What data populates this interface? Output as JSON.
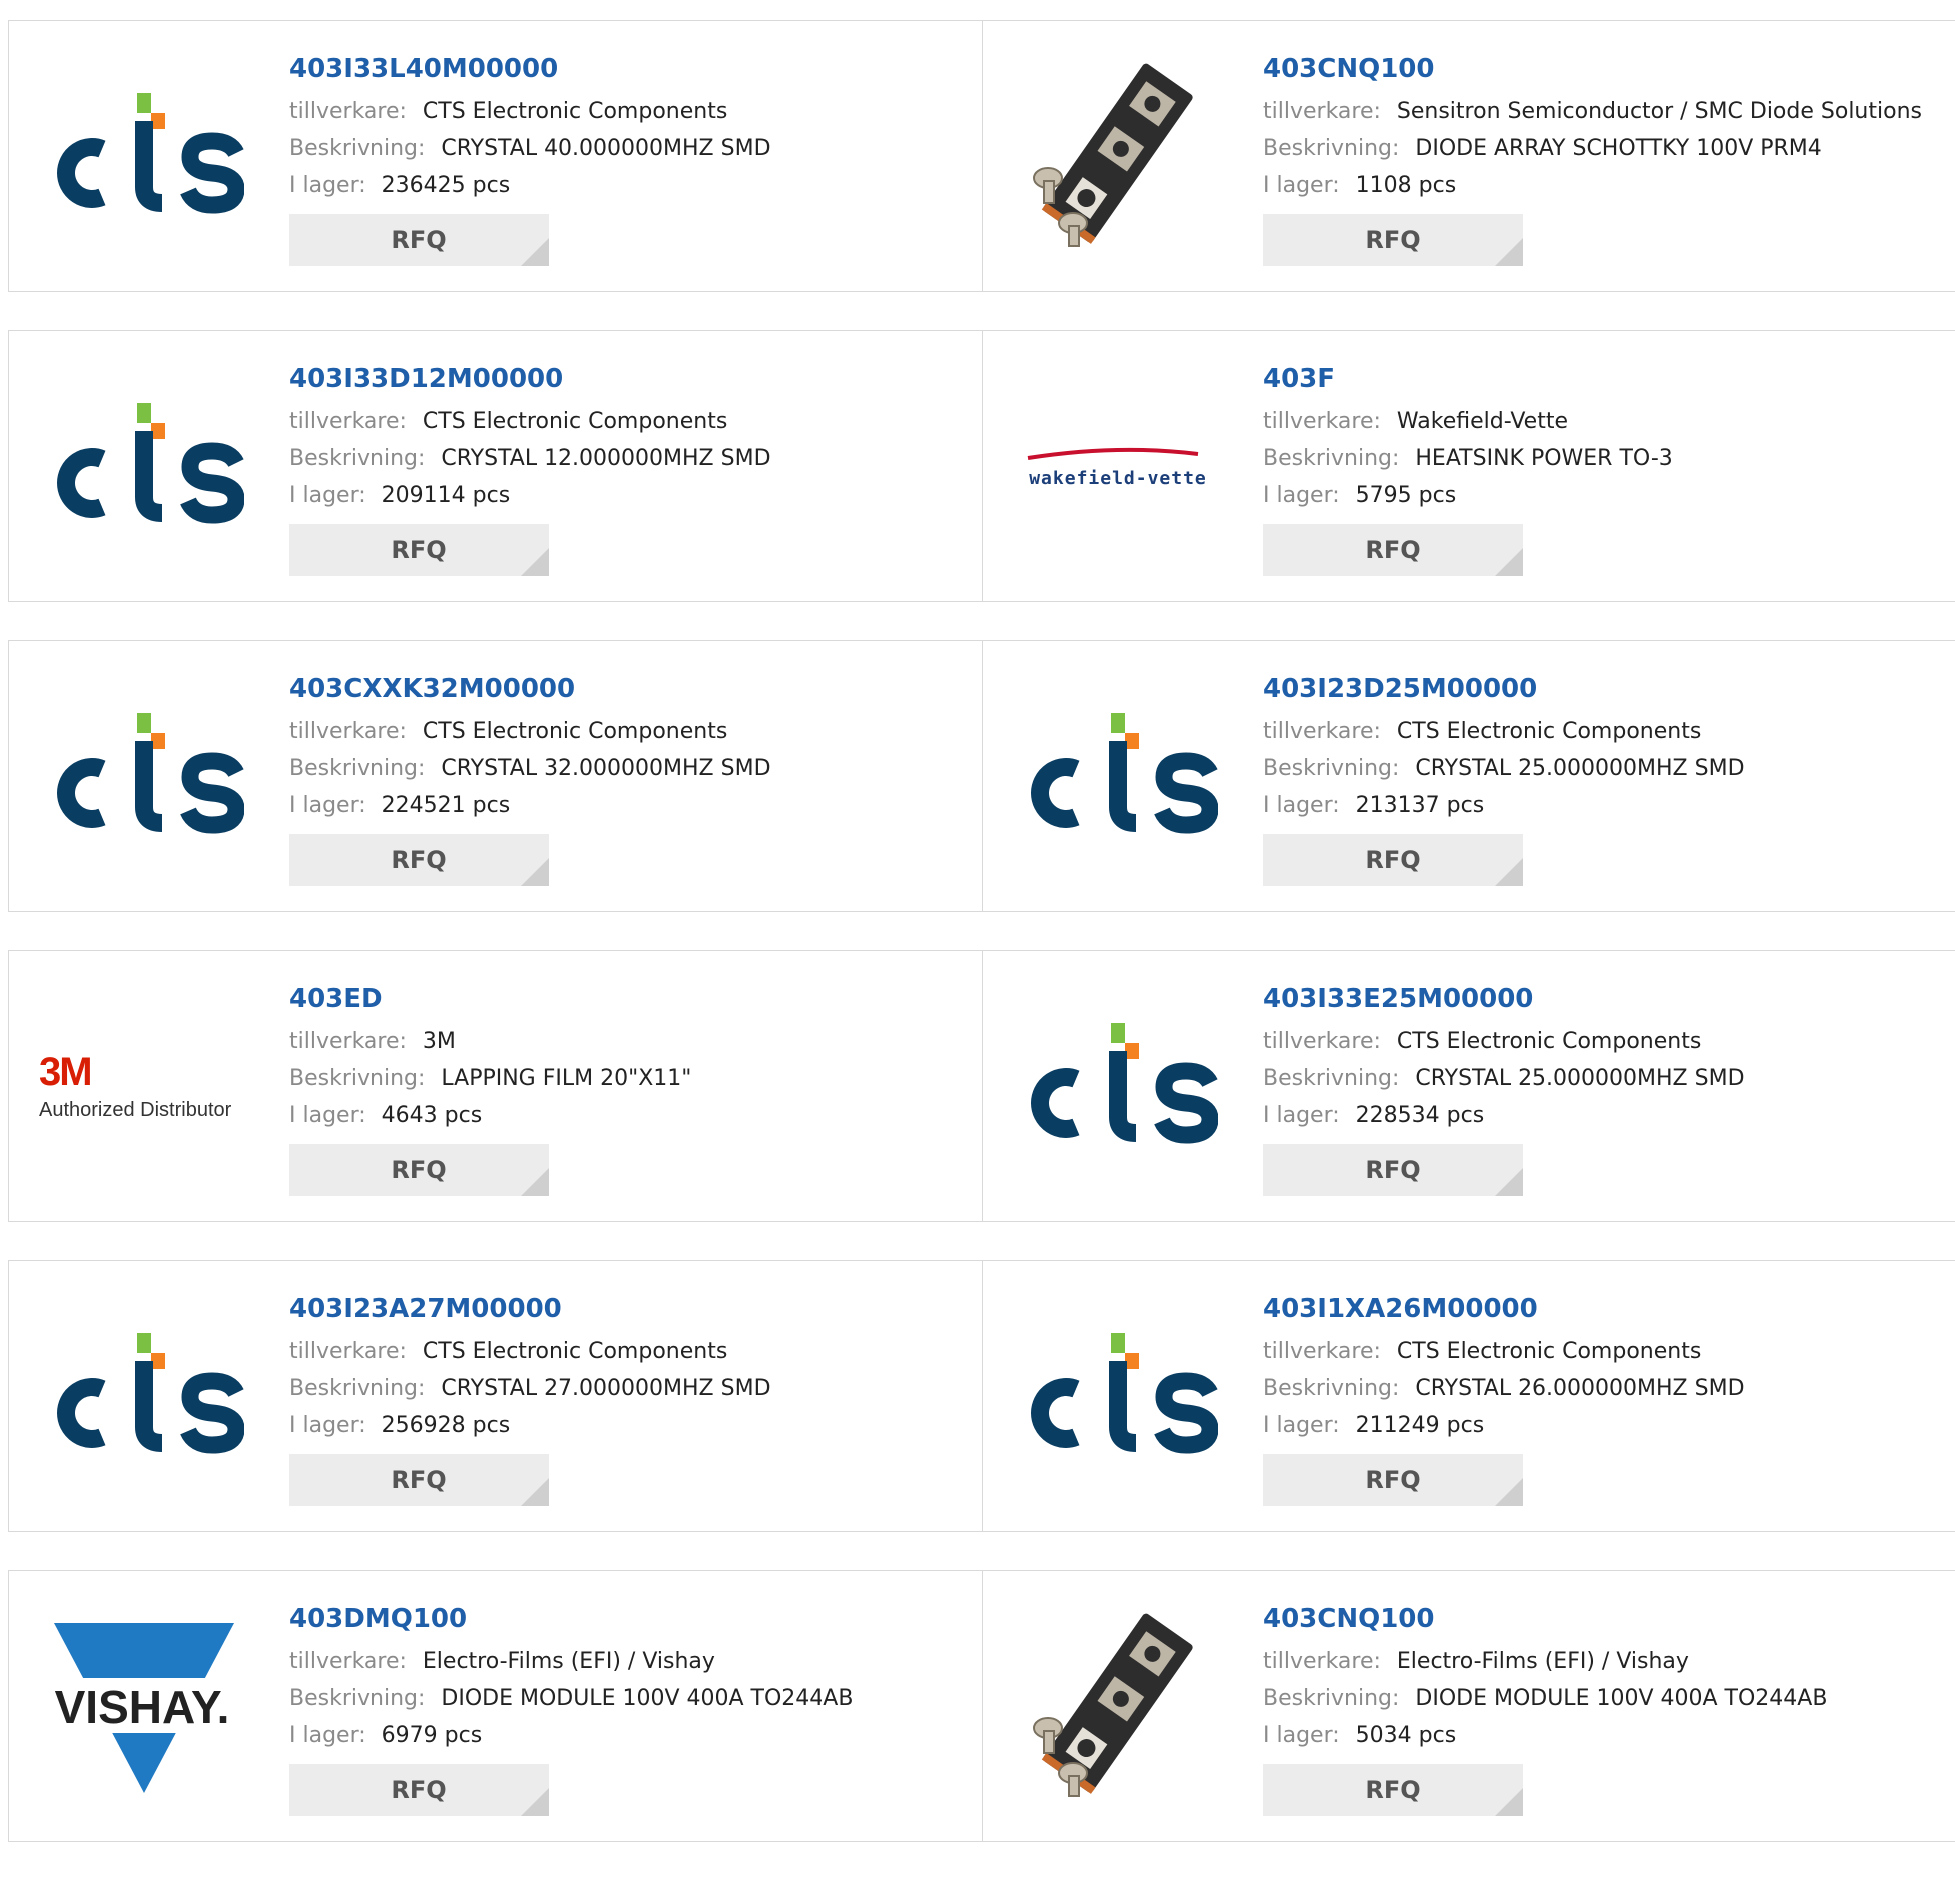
{
  "labels": {
    "manufacturer": "tillverkare:",
    "description": "Beskrivning:",
    "stock": "I lager:",
    "rfq": "RFQ"
  },
  "logos": {
    "cts": "CTS",
    "wakefield": "wakefield-vette",
    "m3_mark": "3M",
    "m3_text": "Authorized Distributor",
    "vishay": "VISHAY."
  },
  "colors": {
    "link": "#1f5ea8",
    "cts_navy": "#0a3d62",
    "cts_green": "#7bc043",
    "cts_orange": "#f58220",
    "vishay_blue": "#1f7ac3"
  },
  "products": [
    {
      "part": "403I33L40M00000",
      "manufacturer": "CTS Electronic Components",
      "description": "CRYSTAL 40.000000MHZ SMD",
      "stock": "236425 pcs",
      "logo": "cts"
    },
    {
      "part": "403CNQ100",
      "manufacturer": "Sensitron Semiconductor / SMC Diode Solutions",
      "description": "DIODE ARRAY SCHOTTKY 100V PRM4",
      "stock": "1108 pcs",
      "logo": "diode-module-photo"
    },
    {
      "part": "403I33D12M00000",
      "manufacturer": "CTS Electronic Components",
      "description": "CRYSTAL 12.000000MHZ SMD",
      "stock": "209114 pcs",
      "logo": "cts"
    },
    {
      "part": "403F",
      "manufacturer": "Wakefield-Vette",
      "description": "HEATSINK POWER TO-3",
      "stock": "5795 pcs",
      "logo": "wakefield"
    },
    {
      "part": "403CXXK32M00000",
      "manufacturer": "CTS Electronic Components",
      "description": "CRYSTAL 32.000000MHZ SMD",
      "stock": "224521 pcs",
      "logo": "cts"
    },
    {
      "part": "403I23D25M00000",
      "manufacturer": "CTS Electronic Components",
      "description": "CRYSTAL 25.000000MHZ SMD",
      "stock": "213137 pcs",
      "logo": "cts"
    },
    {
      "part": "403ED",
      "manufacturer": "3M",
      "description": "LAPPING FILM 20\"X11\"",
      "stock": "4643 pcs",
      "logo": "3m"
    },
    {
      "part": "403I33E25M00000",
      "manufacturer": "CTS Electronic Components",
      "description": "CRYSTAL 25.000000MHZ SMD",
      "stock": "228534 pcs",
      "logo": "cts"
    },
    {
      "part": "403I23A27M00000",
      "manufacturer": "CTS Electronic Components",
      "description": "CRYSTAL 27.000000MHZ SMD",
      "stock": "256928 pcs",
      "logo": "cts"
    },
    {
      "part": "403I1XA26M00000",
      "manufacturer": "CTS Electronic Components",
      "description": "CRYSTAL 26.000000MHZ SMD",
      "stock": "211249 pcs",
      "logo": "cts"
    },
    {
      "part": "403DMQ100",
      "manufacturer": "Electro-Films (EFI) / Vishay",
      "description": "DIODE MODULE 100V 400A TO244AB",
      "stock": "6979 pcs",
      "logo": "vishay"
    },
    {
      "part": "403CNQ100",
      "manufacturer": "Electro-Films (EFI) / Vishay",
      "description": "DIODE MODULE 100V 400A TO244AB",
      "stock": "5034 pcs",
      "logo": "diode-module-photo"
    }
  ]
}
